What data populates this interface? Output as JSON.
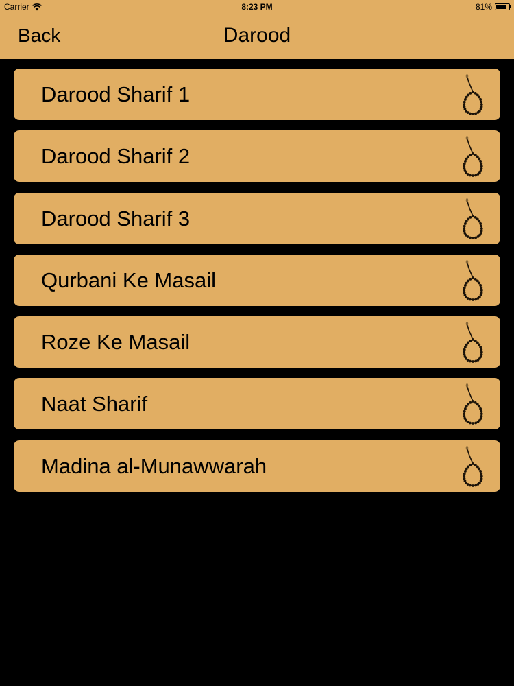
{
  "status_bar": {
    "carrier": "Carrier",
    "time": "8:23 PM",
    "battery_text": "81%",
    "battery_level": 0.81
  },
  "nav": {
    "back_label": "Back",
    "title": "Darood"
  },
  "items": [
    {
      "label": "Darood Sharif 1",
      "icon": "prayer-beads-icon"
    },
    {
      "label": "Darood Sharif 2",
      "icon": "prayer-beads-icon"
    },
    {
      "label": "Darood Sharif 3",
      "icon": "prayer-beads-icon"
    },
    {
      "label": "Qurbani Ke Masail",
      "icon": "prayer-beads-icon"
    },
    {
      "label": "Roze Ke Masail",
      "icon": "prayer-beads-icon"
    },
    {
      "label": "Naat Sharif",
      "icon": "prayer-beads-icon"
    },
    {
      "label": "Madina al-Munawwarah",
      "icon": "prayer-beads-icon"
    }
  ],
  "colors": {
    "bar_background": "#e1ae63",
    "page_background": "#000000",
    "text": "#000000"
  }
}
